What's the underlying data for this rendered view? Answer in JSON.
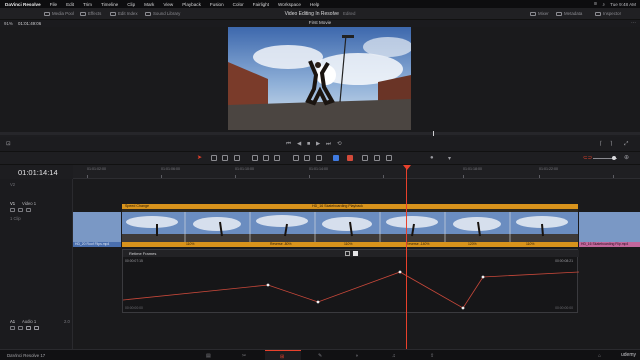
{
  "menubar": {
    "app_name": "DaVinci Resolve",
    "items": [
      "File",
      "Edit",
      "Trim",
      "Timeline",
      "Clip",
      "Mark",
      "View",
      "Playback",
      "Fusion",
      "Color",
      "Fairlight",
      "Workspace",
      "Help"
    ],
    "status_right": "Tue 9:48 AM"
  },
  "toolbar": {
    "media_pool": "Media Pool",
    "effects": "Effects",
    "edit_index": "Edit Index",
    "sound_library": "Sound Library",
    "project_title": "Video Editing In Resolve",
    "project_state": "Edited",
    "mixer": "Mixer",
    "metadata": "Metadata",
    "inspector": "Inspector"
  },
  "viewer": {
    "zoom": "91%",
    "source_timecode": "01:01:49:06",
    "clip_name": "First Movie"
  },
  "timeline": {
    "timecode": "01:01:14:14",
    "ruler_ticks": [
      "01:01:02:00",
      "01:01:06:00",
      "01:01:10:00",
      "01:01:14:00",
      "01:01:18:00",
      "01:01:22:00"
    ],
    "tracks": {
      "v2": "V2",
      "v1": "V1",
      "v1_name": "Video 1",
      "v1_count": "1 Clip",
      "a1": "A1",
      "a1_name": "Audio 1",
      "a1_level": "2.0"
    },
    "speed_change_label": "Speed Change",
    "clip_title": "HD_16 Skateboarding Playback",
    "clip_bar_left": "HD_20 Roof Flips.mp4",
    "clip_bar_right": "HD_16 Skateboarding Flip.mp4",
    "segment_speeds": [
      "110%",
      "Reverse -80%",
      "110%",
      "Reverse -140%",
      "120%",
      "110%"
    ],
    "retime_frames_label": "Retime Frames",
    "retime_left_value": "00:00:07:15",
    "retime_right_value": "00:00:08:21",
    "retime_bottom_left": "00:00:00:00",
    "retime_bottom_right": "00:00:00:00"
  },
  "pagebar": {
    "brand": "DaVinci Resolve 17",
    "watermark": "udemy"
  },
  "colors": {
    "accent": "#e8412c",
    "speed_bar": "#d8931c",
    "clip_bar_blue": "#4a6fae",
    "clip_bar_pink": "#c2679c"
  }
}
